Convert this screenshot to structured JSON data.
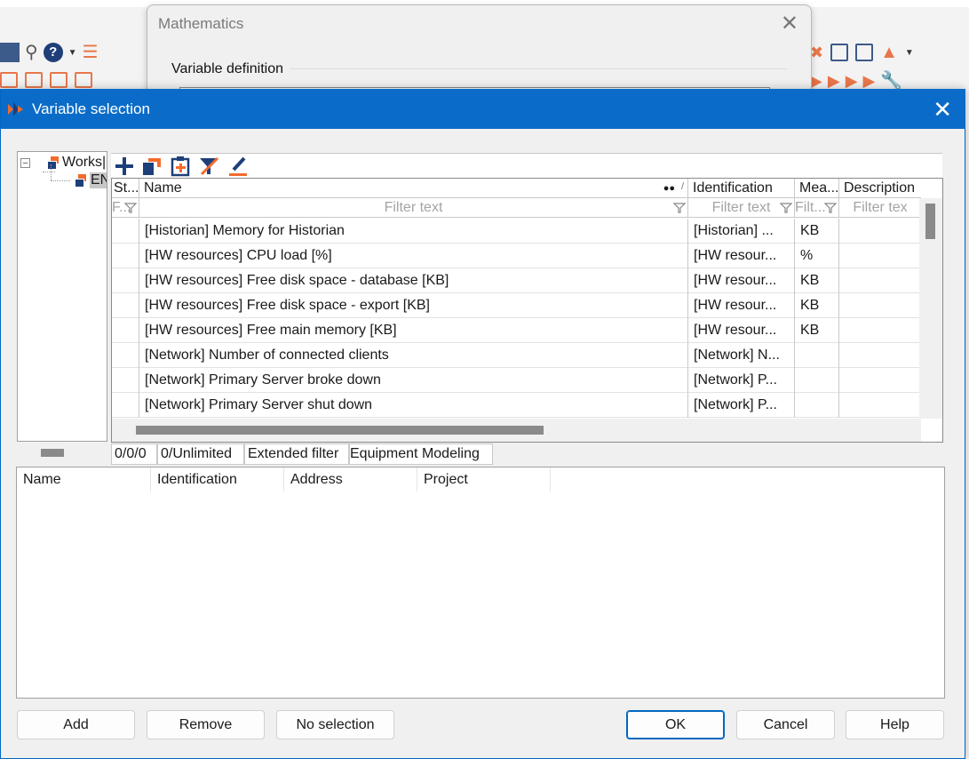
{
  "math_dialog": {
    "title": "Mathematics",
    "group_label": "Variable definition"
  },
  "dialog": {
    "title": "Variable selection"
  },
  "tree": {
    "root_label": "Works|",
    "child_label": "EN"
  },
  "grid": {
    "columns": {
      "status": "St...",
      "name": "Name",
      "identification": "Identification",
      "measure": "Mea...",
      "description": "Description"
    },
    "filters": {
      "status": "F...",
      "name": "Filter text",
      "identification": "Filter text",
      "measure": "Filt...",
      "description": "Filter tex"
    },
    "rows": [
      {
        "name": "[Historian] Memory for Historian",
        "identification": "[Historian] ...",
        "measure": "KB"
      },
      {
        "name": "[HW resources] CPU load [%]",
        "identification": "[HW resour...",
        "measure": "%"
      },
      {
        "name": "[HW resources] Free disk space - database [KB]",
        "identification": "[HW resour...",
        "measure": "KB"
      },
      {
        "name": "[HW resources] Free disk space - export [KB]",
        "identification": "[HW resour...",
        "measure": "KB"
      },
      {
        "name": "[HW resources] Free main memory [KB]",
        "identification": "[HW resour...",
        "measure": "KB"
      },
      {
        "name": "[Network] Number of connected clients",
        "identification": "[Network] N...",
        "measure": ""
      },
      {
        "name": "[Network] Primary Server broke down",
        "identification": "[Network] P...",
        "measure": ""
      },
      {
        "name": "[Network] Primary Server shut down",
        "identification": "[Network] P...",
        "measure": ""
      }
    ]
  },
  "status_bar": {
    "count": "0/0/0",
    "limit": "0/Unlimited",
    "extended_filter": "Extended filter",
    "equipment": "Equipment Modeling"
  },
  "selection_list": {
    "columns": {
      "name": "Name",
      "identification": "Identification",
      "address": "Address",
      "project": "Project"
    }
  },
  "buttons": {
    "add": "Add",
    "remove": "Remove",
    "no_selection": "No selection",
    "ok": "OK",
    "cancel": "Cancel",
    "help": "Help"
  },
  "colors": {
    "titlebar": "#0a6cc8",
    "accent_orange": "#f26b2d",
    "accent_navy": "#1d3f7a"
  }
}
